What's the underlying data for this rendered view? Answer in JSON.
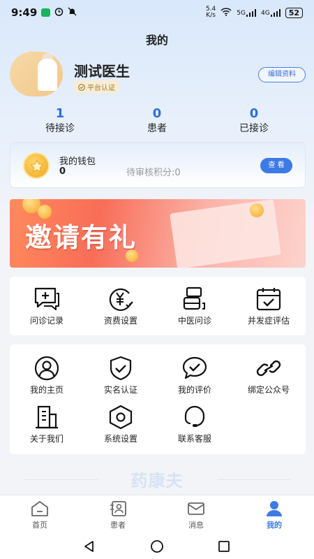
{
  "status_bar": {
    "time": "9:49",
    "net_speed_top": "5.4",
    "net_speed_bottom": "K/s",
    "signal1": "5G",
    "signal2": "4G",
    "battery": "52"
  },
  "page_title": "我的",
  "profile": {
    "name": "测试医生",
    "badge": "平台认证",
    "edit_label": "编辑资料"
  },
  "stats": [
    {
      "value": "1",
      "label": "待接诊"
    },
    {
      "value": "0",
      "label": "患者"
    },
    {
      "value": "0",
      "label": "已接诊"
    }
  ],
  "wallet": {
    "title": "我的钱包",
    "value": "0",
    "pending": "待审核积分:0",
    "view_label": "查 看"
  },
  "banner": {
    "text": "邀请有礼"
  },
  "services": [
    {
      "label": "问诊记录",
      "icon": "consultation-record-icon"
    },
    {
      "label": "资费设置",
      "icon": "fee-settings-icon"
    },
    {
      "label": "中医问诊",
      "icon": "tcm-consultation-icon"
    },
    {
      "label": "并发症评估",
      "icon": "complication-assessment-icon"
    }
  ],
  "menu": [
    {
      "label": "我的主页",
      "icon": "user-profile-icon"
    },
    {
      "label": "实名认证",
      "icon": "shield-check-icon"
    },
    {
      "label": "我的评价",
      "icon": "comment-check-icon"
    },
    {
      "label": "绑定公众号",
      "icon": "link-icon"
    },
    {
      "label": "关于我们",
      "icon": "building-icon"
    },
    {
      "label": "系统设置",
      "icon": "hexagon-settings-icon"
    },
    {
      "label": "联系客服",
      "icon": "headset-icon"
    }
  ],
  "brand": "药康夫",
  "tabs": [
    {
      "label": "首页",
      "icon": "home-icon"
    },
    {
      "label": "患者",
      "icon": "patient-icon"
    },
    {
      "label": "消息",
      "icon": "message-icon"
    },
    {
      "label": "我的",
      "icon": "person-icon",
      "active": true
    }
  ],
  "colors": {
    "accent": "#3d7ae6",
    "stat_number": "#2d6fe0",
    "badge_text": "#a57b2d"
  }
}
